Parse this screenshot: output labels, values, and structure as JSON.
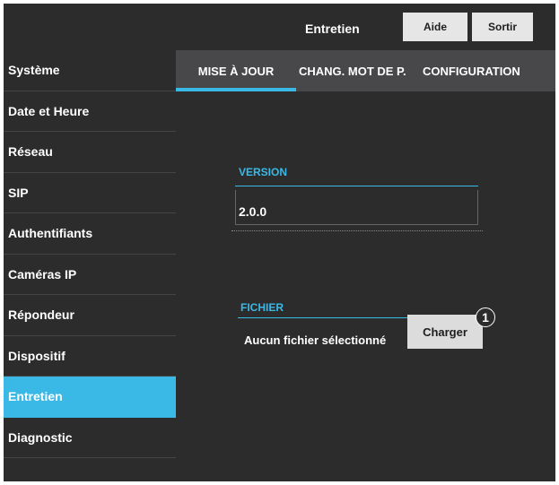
{
  "header": {
    "title": "Entretien",
    "help_label": "Aide",
    "exit_label": "Sortir"
  },
  "sidebar": {
    "items": [
      {
        "label": "Système"
      },
      {
        "label": "Date et Heure"
      },
      {
        "label": "Réseau"
      },
      {
        "label": "SIP"
      },
      {
        "label": "Authentifiants"
      },
      {
        "label": "Caméras IP"
      },
      {
        "label": "Répondeur"
      },
      {
        "label": "Dispositif"
      },
      {
        "label": "Entretien"
      },
      {
        "label": "Diagnostic"
      }
    ],
    "active_item": "Entretien"
  },
  "tabs": [
    {
      "label": "MISE À JOUR",
      "active": true
    },
    {
      "label": "CHANG. MOT DE P."
    },
    {
      "label": "CONFIGURATION"
    }
  ],
  "version": {
    "label": "VERSION",
    "value": "2.0.0"
  },
  "file": {
    "label": "FICHIER",
    "status": "Aucun fichier sélectionné",
    "upload_label": "Charger"
  },
  "callout": {
    "number": "1"
  },
  "colors": {
    "accent": "#3ab9e6",
    "background": "#2c2c2d",
    "tab_bar": "#48484a"
  }
}
